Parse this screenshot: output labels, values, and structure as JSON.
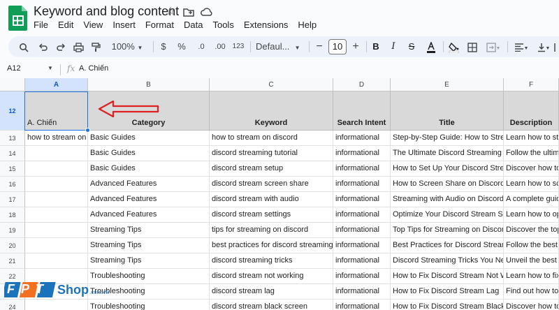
{
  "app": {
    "doc_title": "Keyword and blog content",
    "menus": [
      "File",
      "Edit",
      "View",
      "Insert",
      "Format",
      "Data",
      "Tools",
      "Extensions",
      "Help"
    ]
  },
  "toolbar": {
    "zoom": "100%",
    "currency": "$",
    "percent": "%",
    "dec_decrease": ".0",
    "dec_increase": ".00",
    "number_format": "123",
    "font": "Defaul...",
    "font_size": "10",
    "bold": "B"
  },
  "formula_bar": {
    "cell_ref": "A12",
    "fx": "fx",
    "content": "A. Chiến"
  },
  "columns": [
    "A",
    "B",
    "C",
    "D",
    "E",
    "F"
  ],
  "header_row": {
    "number": "12",
    "cells": [
      "A. Chiến",
      "Category",
      "Keyword",
      "Search Intent",
      "Title",
      "Description"
    ]
  },
  "rows": [
    {
      "n": "13",
      "cells": [
        "how to stream on discord",
        "Basic Guides",
        "how to stream on discord",
        "informational",
        "Step-by-Step Guide: How to Stream on Discord",
        "Learn how to stream"
      ]
    },
    {
      "n": "14",
      "cells": [
        "",
        "Basic Guides",
        "discord streaming tutorial",
        "informational",
        "The Ultimate Discord Streaming Tutorial",
        "Follow the ultimate"
      ]
    },
    {
      "n": "15",
      "cells": [
        "",
        "Basic Guides",
        "discord stream setup",
        "informational",
        "How to Set Up Your Discord Stream",
        "Discover how to set"
      ]
    },
    {
      "n": "16",
      "cells": [
        "",
        "Advanced Features",
        "discord stream screen share",
        "informational",
        "How to Screen Share on Discord",
        "Learn how to screen"
      ]
    },
    {
      "n": "17",
      "cells": [
        "",
        "Advanced Features",
        "discord stream with audio",
        "informational",
        "Streaming with Audio on Discord",
        "A complete guide"
      ]
    },
    {
      "n": "18",
      "cells": [
        "",
        "Advanced Features",
        "discord stream settings",
        "informational",
        "Optimize Your Discord Stream Settings",
        "Learn how to optimize"
      ]
    },
    {
      "n": "19",
      "cells": [
        "",
        "Streaming Tips",
        "tips for streaming on discord",
        "informational",
        "Top Tips for Streaming on Discord",
        "Discover the top tips"
      ]
    },
    {
      "n": "20",
      "cells": [
        "",
        "Streaming Tips",
        "best practices for discord streaming",
        "informational",
        "Best Practices for Discord Streaming",
        "Follow the best"
      ]
    },
    {
      "n": "21",
      "cells": [
        "",
        "Streaming Tips",
        "discord streaming tricks",
        "informational",
        "Discord Streaming Tricks You Need",
        "Unveil the best tricks"
      ]
    },
    {
      "n": "22",
      "cells": [
        "",
        "Troubleshooting",
        "discord stream not working",
        "informational",
        "How to Fix Discord Stream Not Working",
        "Learn how to fix"
      ]
    },
    {
      "n": "23",
      "cells": [
        "",
        "Troubleshooting",
        "discord stream lag",
        "informational",
        "How to Fix Discord Stream Lag",
        "Find out how to"
      ]
    },
    {
      "n": "24",
      "cells": [
        "",
        "Troubleshooting",
        "discord stream black screen",
        "informational",
        "How to Fix Discord Stream Black Screen",
        "Discover how to fix"
      ]
    }
  ],
  "watermark": {
    "brand": "FPT",
    "shop": "Shop",
    "domain": ".com.vn"
  },
  "colors": {
    "selection": "#1a73e8",
    "header_fill": "#d9d9d9",
    "arrow": "#e02020",
    "sheets_green": "#0f9d58",
    "fpt_blue": "#1b74bb",
    "fpt_orange": "#f37021"
  }
}
